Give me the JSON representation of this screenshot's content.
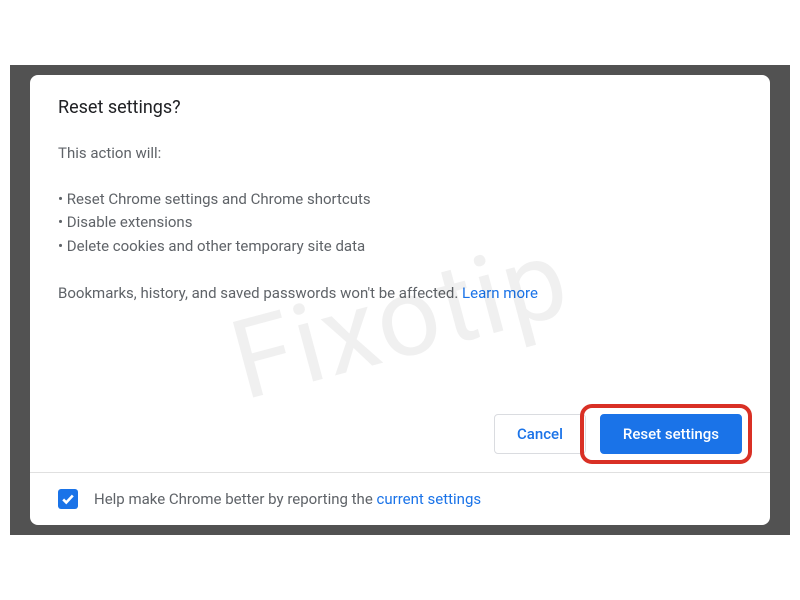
{
  "dialog": {
    "title": "Reset settings?",
    "intro": "This action will:",
    "bullets": [
      "Reset Chrome settings and Chrome shortcuts",
      "Disable extensions",
      "Delete cookies and other temporary site data"
    ],
    "note_before": "Bookmarks, history, and saved passwords won't be affected. ",
    "note_link": "Learn more"
  },
  "buttons": {
    "cancel": "Cancel",
    "confirm": "Reset settings"
  },
  "footer": {
    "checkbox_checked": true,
    "text_before": "Help make Chrome better by reporting the ",
    "link": "current settings"
  },
  "watermark": "Fixotip"
}
